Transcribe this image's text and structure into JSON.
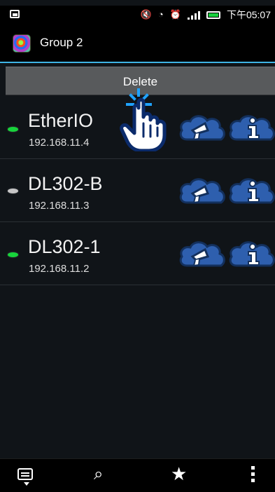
{
  "status_bar": {
    "time": "下午05:07",
    "icons": [
      "image-notification-icon",
      "muted-icon",
      "wifi-icon",
      "alarm-icon",
      "signal-icon",
      "battery-icon"
    ],
    "battery_color": "#19d13e"
  },
  "app_bar": {
    "title": "Group 2",
    "icon": "app-logo-icon"
  },
  "context_action": {
    "delete_label": "Delete"
  },
  "devices": [
    {
      "name": "EtherIO",
      "ip": "192.168.11.4",
      "status": "online",
      "status_color": "#17d43b"
    },
    {
      "name": "DL302-B",
      "ip": "192.168.11.3",
      "status": "offline",
      "status_color": "#c6c6c6"
    },
    {
      "name": "DL302-1",
      "ip": "192.168.11.2",
      "status": "online",
      "status_color": "#17d43b"
    }
  ],
  "row_actions": {
    "first_icon": "megaphone-cloud-icon",
    "second_icon": "info-cloud-icon",
    "cloud_color": "#2e5fae"
  },
  "bottom_bar": {
    "icons": [
      "keyboard-icon",
      "search-icon",
      "star-icon",
      "more-icon"
    ]
  },
  "overlay": {
    "icon": "hand-pointer-icon"
  }
}
